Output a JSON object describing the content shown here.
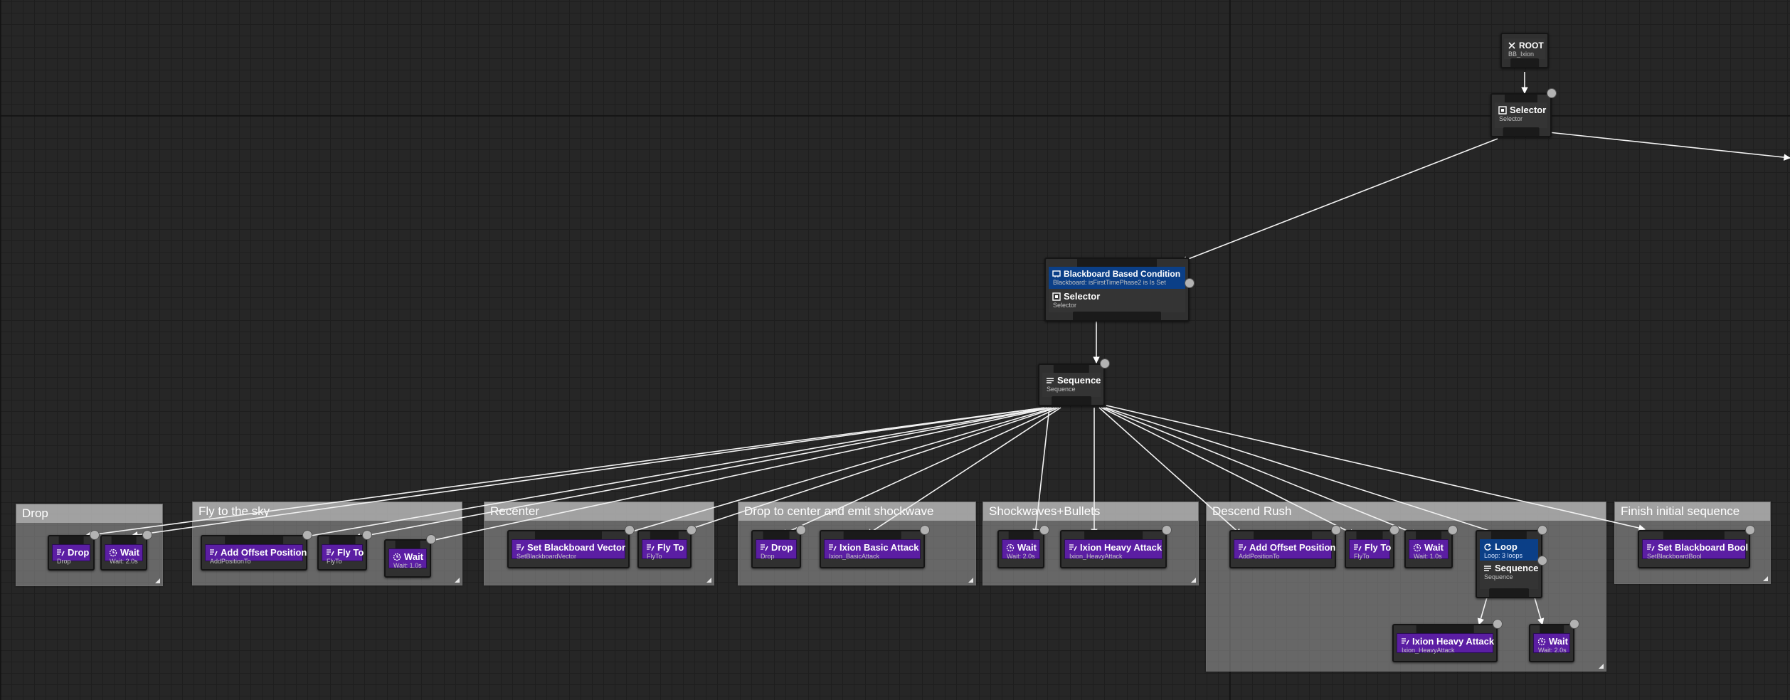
{
  "comments": {
    "drop": "Drop",
    "fly_sky": "Fly to the sky",
    "recenter": "Recenter",
    "drop_center": "Drop to center and emit shockwave",
    "shockwaves": "Shockwaves+Bullets",
    "descend": "Descend Rush",
    "finish": "Finish initial sequence"
  },
  "nodes": {
    "root": {
      "title": "ROOT",
      "sub": "BB_Ixion"
    },
    "selector_main": {
      "title": "Selector",
      "sub": "Selector"
    },
    "decorator": {
      "title": "Blackboard Based Condition",
      "sub": "Blackboard: isFirstTimePhase2 is Is Set"
    },
    "selector_inner": {
      "title": "Selector",
      "sub": "Selector"
    },
    "sequence_main": {
      "title": "Sequence",
      "sub": "Sequence"
    },
    "drop1": {
      "title": "Drop",
      "sub": "Drop"
    },
    "wait1": {
      "title": "Wait",
      "sub": "Wait: 2.0s"
    },
    "add_offset1": {
      "title": "Add Offset Position",
      "sub": "AddPositionTo"
    },
    "flyto1": {
      "title": "Fly To",
      "sub": "FlyTo"
    },
    "wait2": {
      "title": "Wait",
      "sub": "Wait: 1.0s"
    },
    "set_bb_vector": {
      "title": "Set Blackboard Vector",
      "sub": "SetBlackboardVector"
    },
    "flyto2": {
      "title": "Fly To",
      "sub": "FlyTo"
    },
    "drop2": {
      "title": "Drop",
      "sub": "Drop"
    },
    "basic_attack": {
      "title": "Ixion Basic Attack",
      "sub": "Ixion_BasicAttack"
    },
    "wait3": {
      "title": "Wait",
      "sub": "Wait: 2.0s"
    },
    "heavy_attack1": {
      "title": "Ixion Heavy Attack",
      "sub": "Ixion_HeavyAttack"
    },
    "add_offset2": {
      "title": "Add Offset Position",
      "sub": "AddPositionTo"
    },
    "flyto3": {
      "title": "Fly To",
      "sub": "FlyTo"
    },
    "wait4": {
      "title": "Wait",
      "sub": "Wait: 1.0s"
    },
    "loop": {
      "title": "Loop",
      "sub": "Loop: 3 loops"
    },
    "sequence_loop": {
      "title": "Sequence",
      "sub": "Sequence"
    },
    "heavy_attack2": {
      "title": "Ixion Heavy Attack",
      "sub": "Ixion_HeavyAttack"
    },
    "wait5": {
      "title": "Wait",
      "sub": "Wait: 2.0s"
    },
    "set_bb_bool": {
      "title": "Set Blackboard Bool",
      "sub": "SetBlackboardBool"
    }
  },
  "icons": {
    "root": "root-icon",
    "composite": "selector-icon",
    "sequence": "sequence-icon",
    "decorator": "blackboard-condition-icon",
    "task": "task-icon",
    "wait": "wait-clock-icon",
    "loop": "loop-icon"
  },
  "colors": {
    "task": "#5b1ea3",
    "decorator": "#0b3f87",
    "node": "#343434",
    "edge": "#ffffff",
    "grid_bg": "#262626"
  }
}
